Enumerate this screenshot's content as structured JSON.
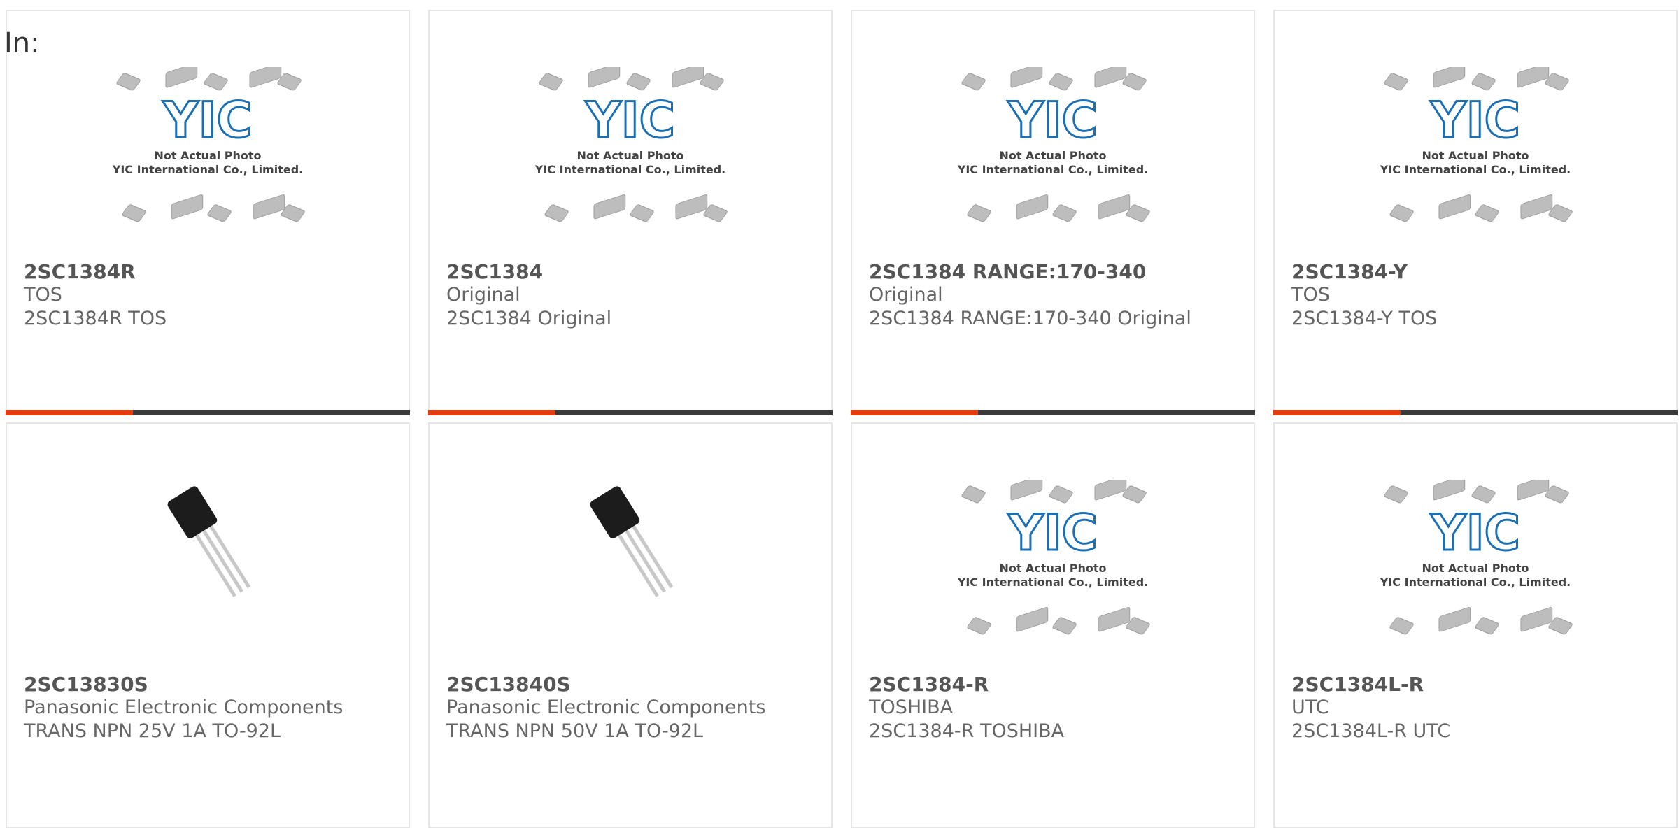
{
  "filter": {
    "label": "In:"
  },
  "placeholder": {
    "logo": "YIC",
    "line1": "Not Actual Photo",
    "line2": "YIC International Co., Limited."
  },
  "colors": {
    "accent": "#e63c12",
    "bar": "#3a3a3a",
    "border": "#e6e6e6",
    "logo_blue": "#1a6fb5"
  },
  "products": [
    {
      "part": "2SC1384R",
      "manufacturer": "TOS",
      "description": "2SC1384R TOS",
      "image": "placeholder",
      "accent_bar": true
    },
    {
      "part": "2SC1384",
      "manufacturer": "Original",
      "description": "2SC1384 Original",
      "image": "placeholder",
      "accent_bar": true
    },
    {
      "part": "2SC1384 RANGE:170-340",
      "manufacturer": "Original",
      "description": "2SC1384 RANGE:170-340 Original",
      "image": "placeholder",
      "accent_bar": true
    },
    {
      "part": "2SC1384-Y",
      "manufacturer": "TOS",
      "description": "2SC1384-Y TOS",
      "image": "placeholder",
      "accent_bar": true
    },
    {
      "part": "2SC13830S",
      "manufacturer": "Panasonic Electronic Components",
      "description": "TRANS NPN 25V 1A TO-92L",
      "image": "to92-transistor",
      "accent_bar": false
    },
    {
      "part": "2SC13840S",
      "manufacturer": "Panasonic Electronic Components",
      "description": "TRANS NPN 50V 1A TO-92L",
      "image": "to92-transistor",
      "accent_bar": false
    },
    {
      "part": "2SC1384-R",
      "manufacturer": "TOSHIBA",
      "description": "2SC1384-R TOSHIBA",
      "image": "placeholder",
      "accent_bar": false
    },
    {
      "part": "2SC1384L-R",
      "manufacturer": "UTC",
      "description": "2SC1384L-R UTC",
      "image": "placeholder",
      "accent_bar": false
    }
  ]
}
